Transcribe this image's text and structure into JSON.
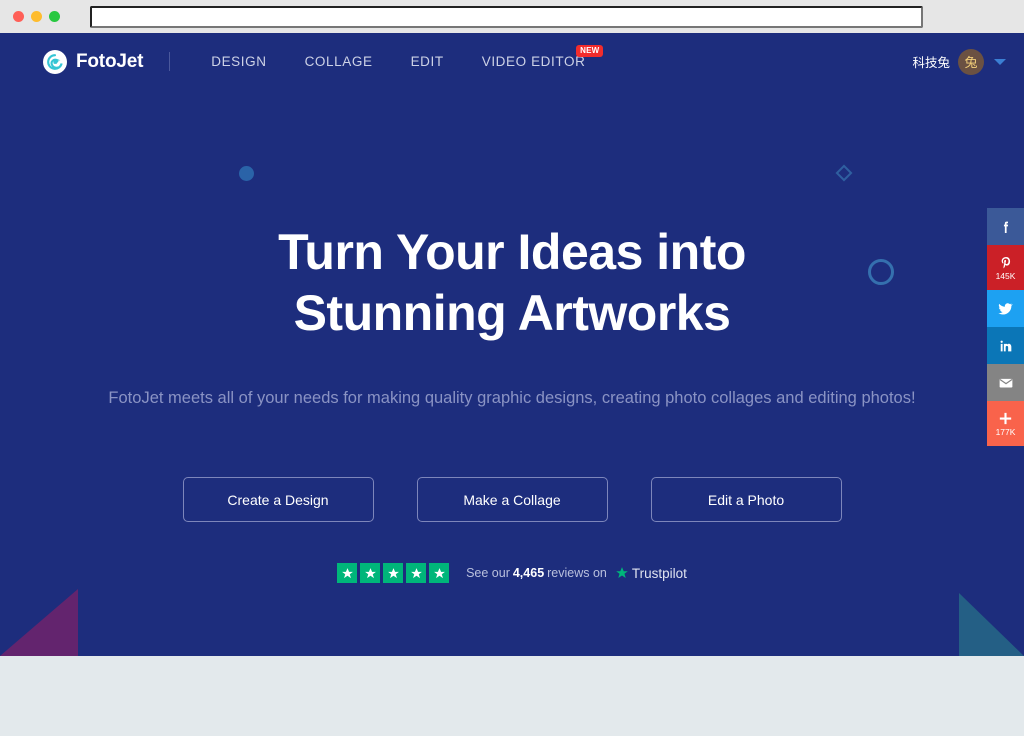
{
  "browser": {
    "traffic_lights": [
      "close-red",
      "minimize-yellow",
      "maximize-green"
    ],
    "url_value": "",
    "url_placeholder": ""
  },
  "nav": {
    "brand": "FotoJet",
    "logo_icon": "fotojet-spiral-icon",
    "links": [
      {
        "label": "DESIGN",
        "badge": ""
      },
      {
        "label": "COLLAGE",
        "badge": ""
      },
      {
        "label": "EDIT",
        "badge": ""
      },
      {
        "label": "VIDEO EDITOR",
        "badge": "NEW"
      }
    ],
    "user": {
      "name": "科技兔",
      "avatar_initial": "兔",
      "caret_icon": "chevron-down-icon"
    }
  },
  "hero": {
    "headline_line1": "Turn Your Ideas into",
    "headline_line2": "Stunning Artworks",
    "subhead": "FotoJet meets all of your needs for making quality graphic designs, creating photo collages and editing photos!",
    "buttons": [
      {
        "label": "Create a Design"
      },
      {
        "label": "Make a Collage"
      },
      {
        "label": "Edit a Photo"
      }
    ],
    "decorations": [
      "filled-circle",
      "diamond-outline",
      "ring-outline",
      "purple-triangle",
      "teal-triangle"
    ]
  },
  "trustpilot": {
    "star_count": 5,
    "prefix": "See our",
    "review_count": "4,465",
    "suffix": "reviews on",
    "brand": "Trustpilot",
    "star_icon": "star-icon",
    "brand_star_icon": "trustpilot-star-icon"
  },
  "social_rail": [
    {
      "network": "facebook",
      "icon": "facebook-icon",
      "count": "",
      "color": "#3b5998"
    },
    {
      "network": "pinterest",
      "icon": "pinterest-icon",
      "count": "145K",
      "color": "#cb2027"
    },
    {
      "network": "twitter",
      "icon": "twitter-icon",
      "count": "",
      "color": "#1da1f2"
    },
    {
      "network": "linkedin",
      "icon": "linkedin-icon",
      "count": "",
      "color": "#0b76b7"
    },
    {
      "network": "email",
      "icon": "envelope-icon",
      "count": "",
      "color": "#848484"
    },
    {
      "network": "share",
      "icon": "plus-icon",
      "count": "177K",
      "color": "#f9634b"
    }
  ],
  "colors": {
    "hero_bg": "#1d2d7d",
    "page_bg": "#e3e9ec",
    "chrome_bg": "#e6e6e6",
    "accent_teal": "#35c5d4",
    "trust_green": "#00b67a",
    "badge_red": "#f22c2c",
    "triangle_purple": "#63246e",
    "triangle_teal": "#245f85"
  }
}
